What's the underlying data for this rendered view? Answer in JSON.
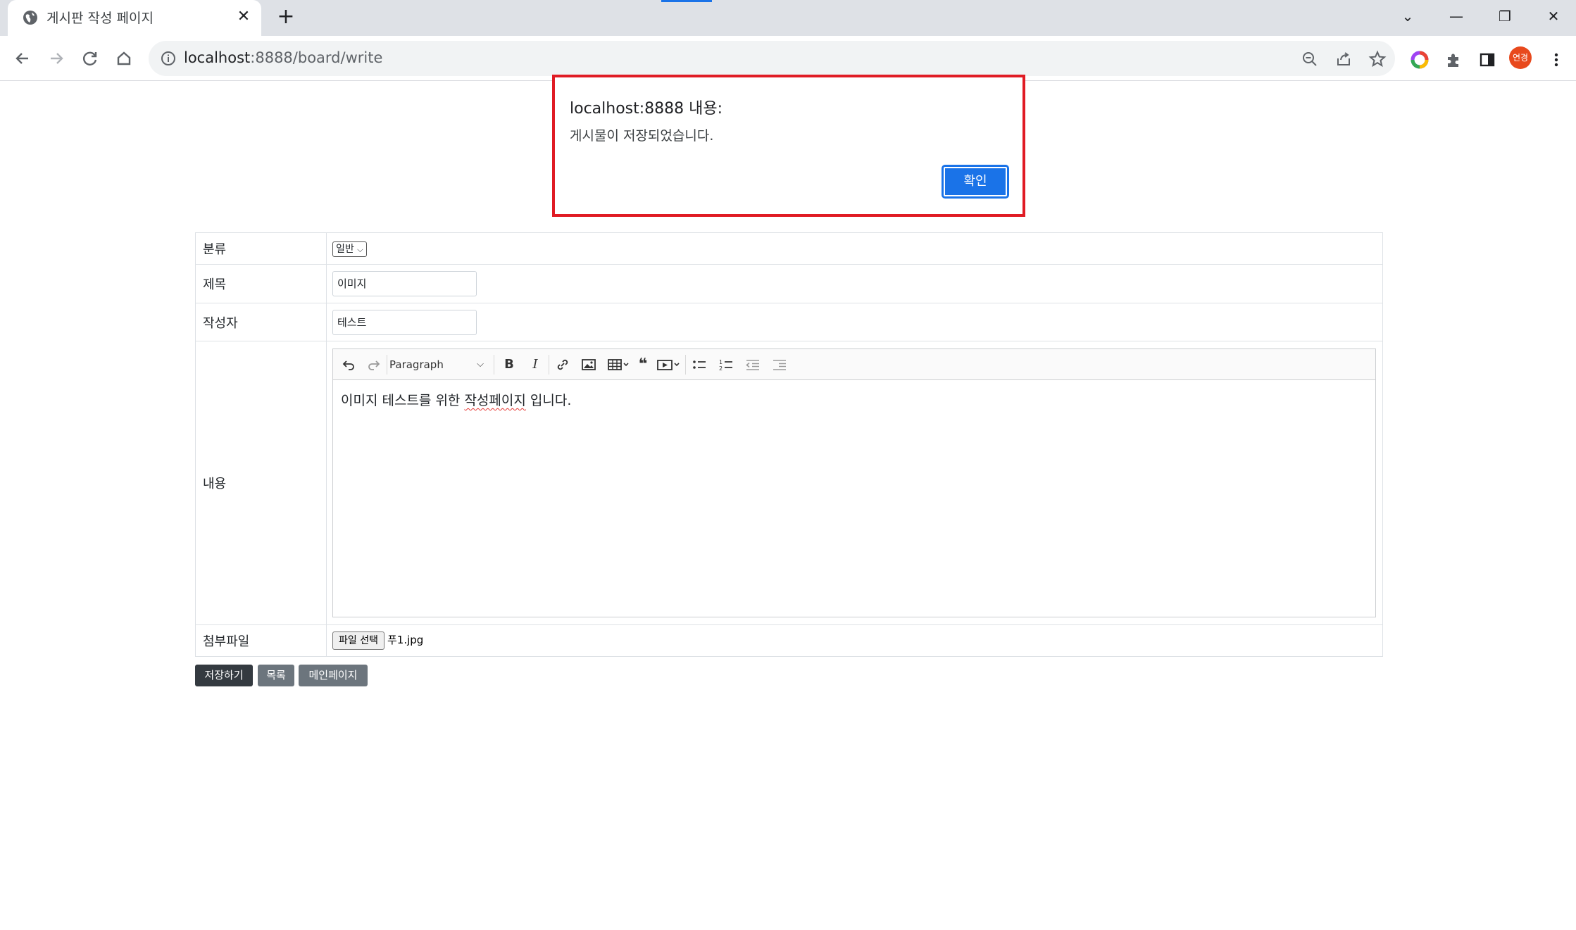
{
  "browser": {
    "tab_title": "게시판 작성 페이지",
    "tab_close": "✕",
    "new_tab": "+",
    "url_host": "localhost",
    "url_rest": ":8888/board/write",
    "profile_label": "연경",
    "window_controls": {
      "dropdown": "⌄",
      "minimize": "—",
      "restore": "❐",
      "close": "✕"
    }
  },
  "form": {
    "category": {
      "label": "분류",
      "value": "일반"
    },
    "title": {
      "label": "제목",
      "value": "이미지"
    },
    "author": {
      "label": "작성자",
      "value": "테스트"
    },
    "content": {
      "label": "내용",
      "format_select": "Paragraph",
      "text_before": "이미지 테스트를 위한 ",
      "text_misspelled": "작성페이지",
      "text_after": " 입니다."
    },
    "attachment": {
      "label": "첨부파일",
      "button": "파일 선택",
      "file_name": "푸1.jpg"
    }
  },
  "actions": {
    "save": "저장하기",
    "list": "목록",
    "main": "메인페이지"
  },
  "colors": {
    "save_bg": "#343a40",
    "secondary_bg": "#6c757d",
    "dialog_accent": "#1a73e8",
    "highlight": "#e01b24"
  },
  "dialog": {
    "title": "localhost:8888 내용:",
    "message": "게시물이 저장되었습니다.",
    "ok": "확인"
  }
}
